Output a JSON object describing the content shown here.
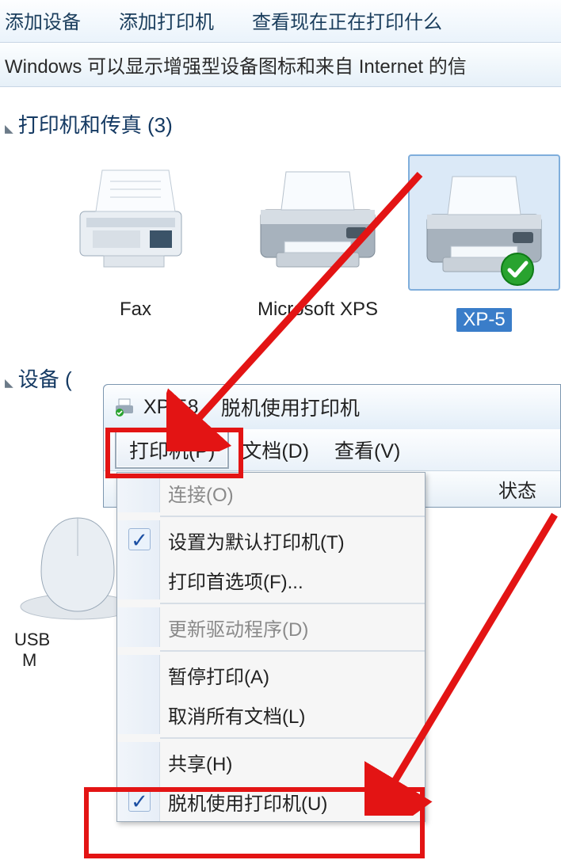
{
  "toolbar": {
    "add_device": "添加设备",
    "add_printer": "添加打印机",
    "view_queue": "查看现在正在打印什么"
  },
  "infobar": "Windows 可以显示增强型设备图标和来自 Internet 的信",
  "section_printers": {
    "title": "打印机和传真 (3)",
    "items": [
      {
        "label": "Fax"
      },
      {
        "label": "Microsoft XPS"
      },
      {
        "label": "XP-5"
      }
    ]
  },
  "section_devices": {
    "title": "设备 (",
    "item1_line1": "USB",
    "item1_line2": "M"
  },
  "queue": {
    "title_printer": "XP-58",
    "title_suffix": "脱机使用打印机",
    "menu_printer": "打印机(P)",
    "menu_document": "文档(D)",
    "menu_view": "查看(V)",
    "col_status": "状态"
  },
  "dropdown": {
    "connect": "连接(O)",
    "set_default": "设置为默认打印机(T)",
    "preferences": "打印首选项(F)...",
    "update_driver": "更新驱动程序(D)",
    "pause": "暂停打印(A)",
    "cancel_all": "取消所有文档(L)",
    "sharing": "共享(H)",
    "offline": "脱机使用打印机(U)"
  }
}
